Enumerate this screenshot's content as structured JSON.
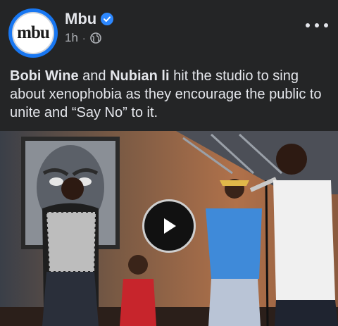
{
  "post": {
    "page_name": "Mbu",
    "avatar_text": "mbu",
    "time": "1h",
    "separator": "·",
    "caption": {
      "name1": "Bobi Wine",
      "and": " and ",
      "name2": "Nubian li",
      "rest": " hit the studio to sing about xenophobia as they encourage the public to unite and “Say No” to it."
    }
  },
  "icons": {
    "verified": "verified-badge-icon",
    "audience": "globe-icon",
    "more": "more-options-icon",
    "play": "play-icon"
  },
  "colors": {
    "background": "#242526",
    "primary_text": "#e4e6eb",
    "secondary_text": "#b0b3b8",
    "accent": "#1877f2"
  }
}
